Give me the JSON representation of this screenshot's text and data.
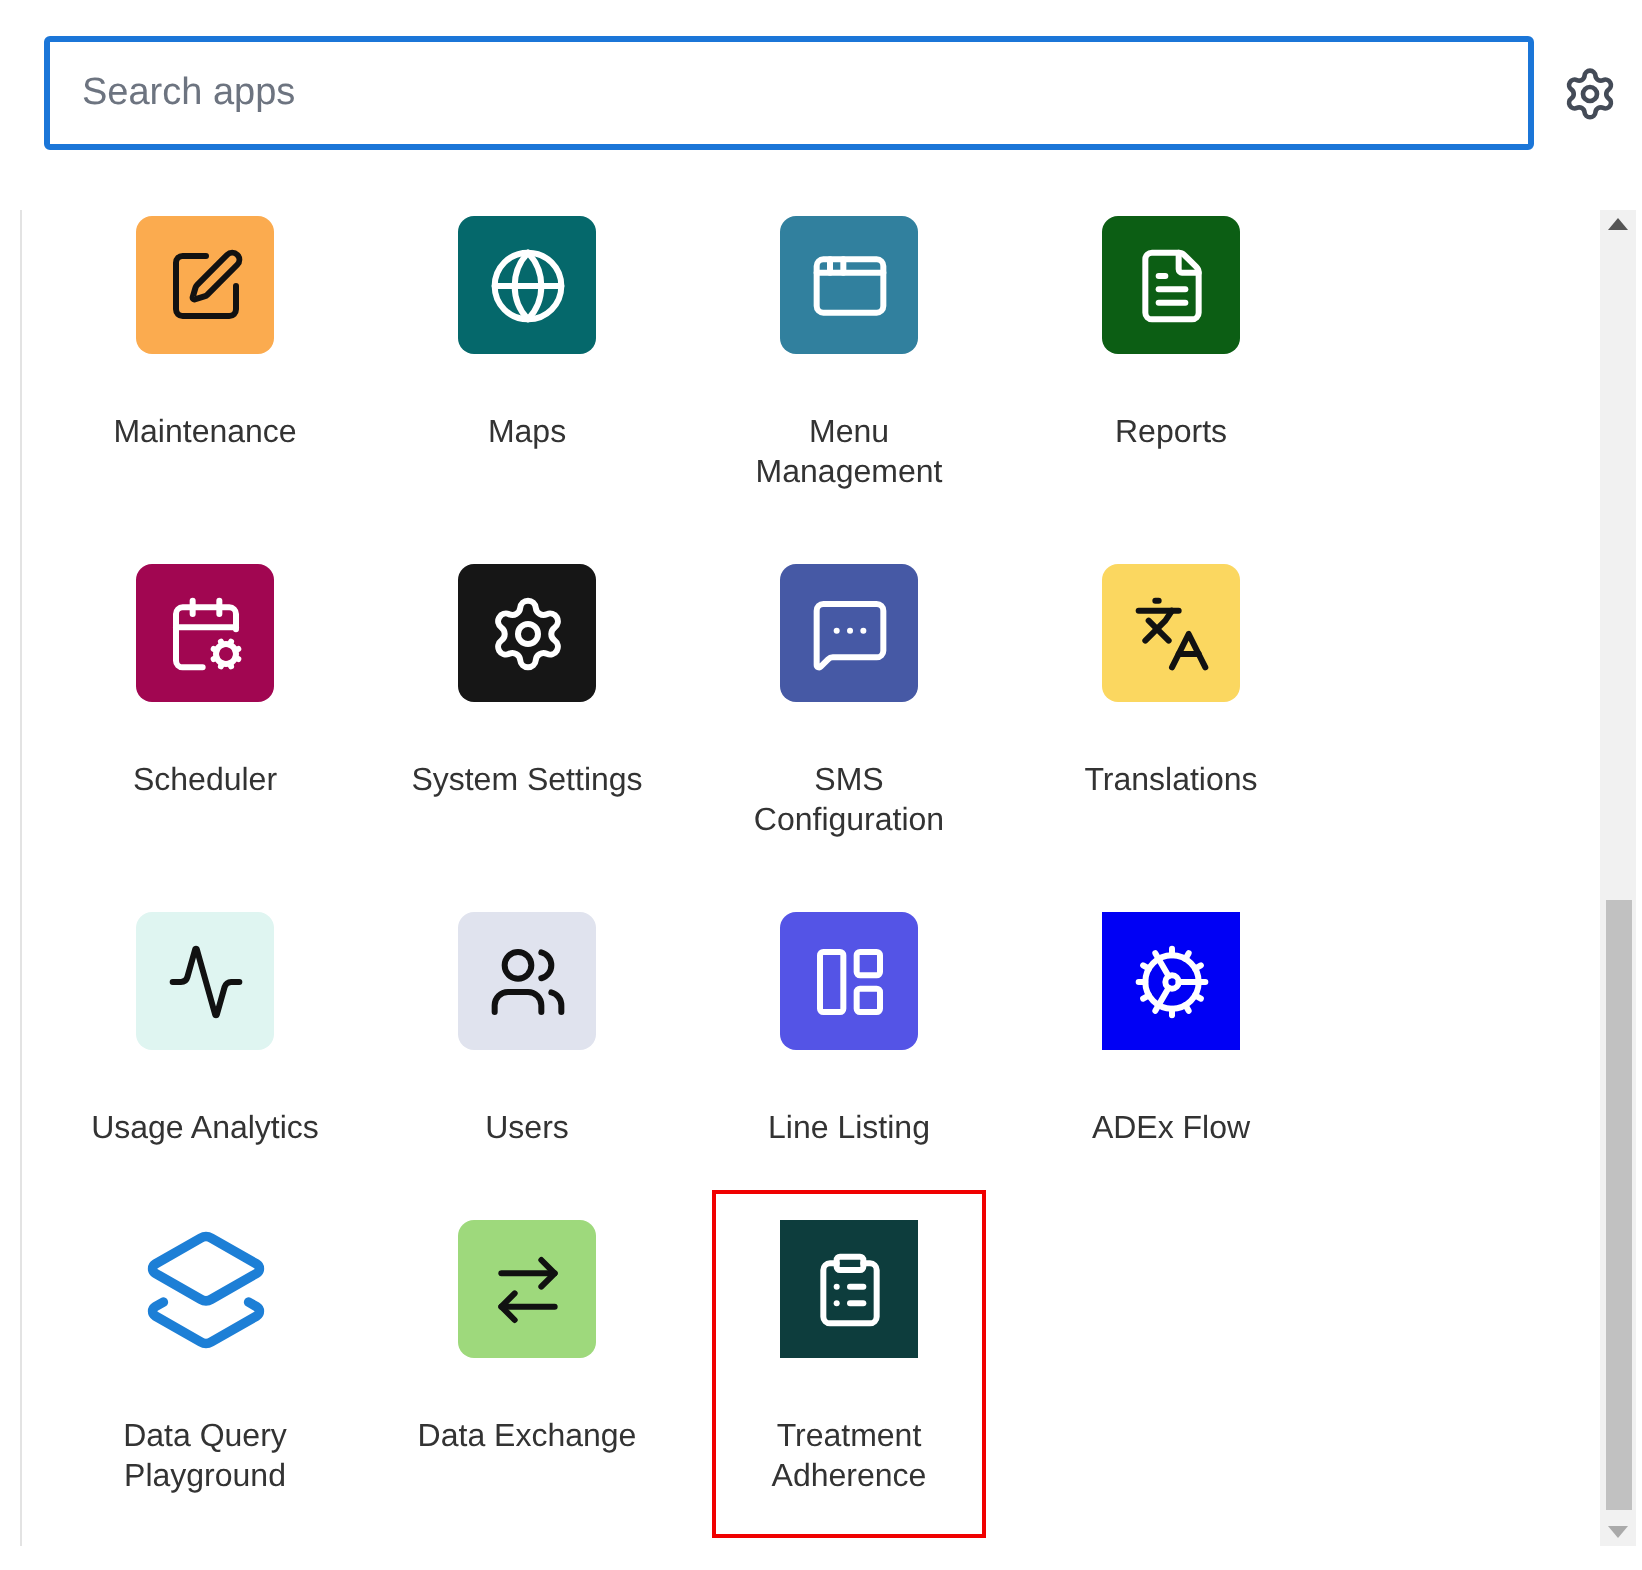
{
  "search": {
    "placeholder": "Search apps"
  },
  "apps": [
    {
      "label": "Maintenance",
      "kind": "maintenance",
      "color": "#fbab4f",
      "rounded": true,
      "selected": false
    },
    {
      "label": "Maps",
      "kind": "maps",
      "color": "#05686b",
      "rounded": true,
      "selected": false
    },
    {
      "label": "Menu Management",
      "kind": "menu",
      "color": "#31809e",
      "rounded": true,
      "selected": false
    },
    {
      "label": "Reports",
      "kind": "reports",
      "color": "#0c5e14",
      "rounded": true,
      "selected": false
    },
    {
      "label": "Scheduler",
      "kind": "scheduler",
      "color": "#a10651",
      "rounded": true,
      "selected": false
    },
    {
      "label": "System Settings",
      "kind": "settings",
      "color": "#161616",
      "rounded": true,
      "selected": false
    },
    {
      "label": "SMS Configuration",
      "kind": "sms",
      "color": "#4659a5",
      "rounded": true,
      "selected": false
    },
    {
      "label": "Translations",
      "kind": "translations",
      "color": "#fbd760",
      "rounded": true,
      "selected": false
    },
    {
      "label": "Usage Analytics",
      "kind": "analytics",
      "color": "#dff5f1",
      "rounded": true,
      "selected": false
    },
    {
      "label": "Users",
      "kind": "users",
      "color": "#e0e3ee",
      "rounded": true,
      "selected": false
    },
    {
      "label": "Line Listing",
      "kind": "linelisting",
      "color": "#5454e6",
      "rounded": true,
      "selected": false
    },
    {
      "label": "ADEx Flow",
      "kind": "adex",
      "color": "#0000f5",
      "rounded": false,
      "selected": false
    },
    {
      "label": "Data Query Playground",
      "kind": "dataquery",
      "color": "#ffffff",
      "selected": false
    },
    {
      "label": "Data Exchange",
      "kind": "exchange",
      "color": "#9ed97c",
      "rounded": true,
      "selected": false
    },
    {
      "label": "Treatment Adherence",
      "kind": "treatment",
      "color": "#0d3d3d",
      "rounded": false,
      "selected": true
    }
  ]
}
